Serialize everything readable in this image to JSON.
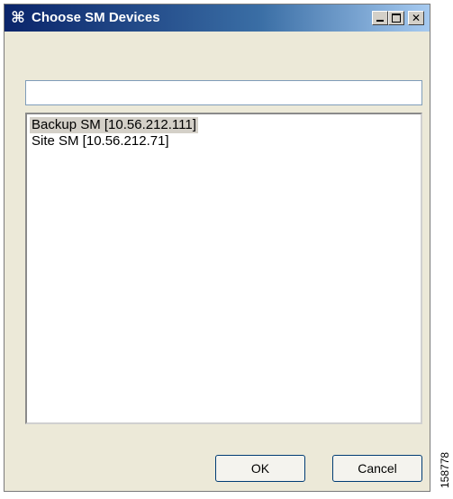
{
  "window": {
    "title": "Choose SM Devices",
    "icon": "app-cross-icon",
    "controls": [
      "minimize-icon",
      "maximize-icon",
      "close-icon"
    ]
  },
  "filter": {
    "value": ""
  },
  "devices": [
    {
      "label": "Backup SM [10.56.212.111]",
      "selected": true
    },
    {
      "label": "Site SM [10.56.212.71]",
      "selected": false
    }
  ],
  "buttons": {
    "ok_label": "OK",
    "cancel_label": "Cancel"
  },
  "figure_id": "158778",
  "colors": {
    "titlebar_start": "#0a246a",
    "dialog_bg": "#ece9d8",
    "selection": "#d4d0c8"
  }
}
